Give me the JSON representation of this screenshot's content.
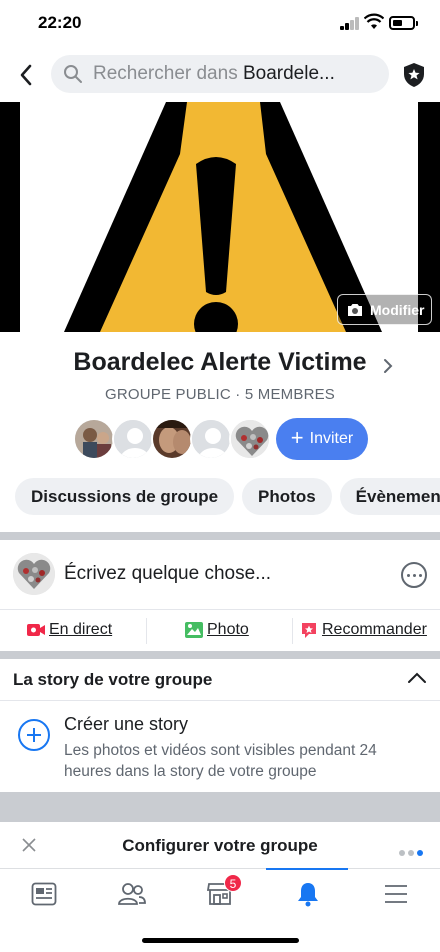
{
  "status_bar": {
    "time": "22:20"
  },
  "search": {
    "placeholder_prefix": "Rechercher dans ",
    "placeholder_group": "Boardele..."
  },
  "cover": {
    "modify_label": "Modifier"
  },
  "group": {
    "name": "Boardelec Alerte Victime",
    "meta": "GROUPE PUBLIC · 5 MEMBRES",
    "invite_label": "Inviter"
  },
  "chips": [
    "Discussions de groupe",
    "Photos",
    "Évènements"
  ],
  "composer": {
    "placeholder": "Écrivez quelque chose..."
  },
  "actions": {
    "live": "En direct",
    "photo": "Photo",
    "recommend": "Recommander"
  },
  "story": {
    "header": "La story de votre groupe",
    "create_title": "Créer une story",
    "create_desc": "Les photos et vidéos sont visibles pendant 24 heures dans la story de votre groupe"
  },
  "setup": {
    "label": "Configurer votre groupe"
  },
  "tabbar": {
    "marketplace_badge": "5"
  },
  "colors": {
    "accent": "#1877f2",
    "invite": "#4a7ff0",
    "badge": "#f02849",
    "warning_yellow": "#f2b833"
  }
}
